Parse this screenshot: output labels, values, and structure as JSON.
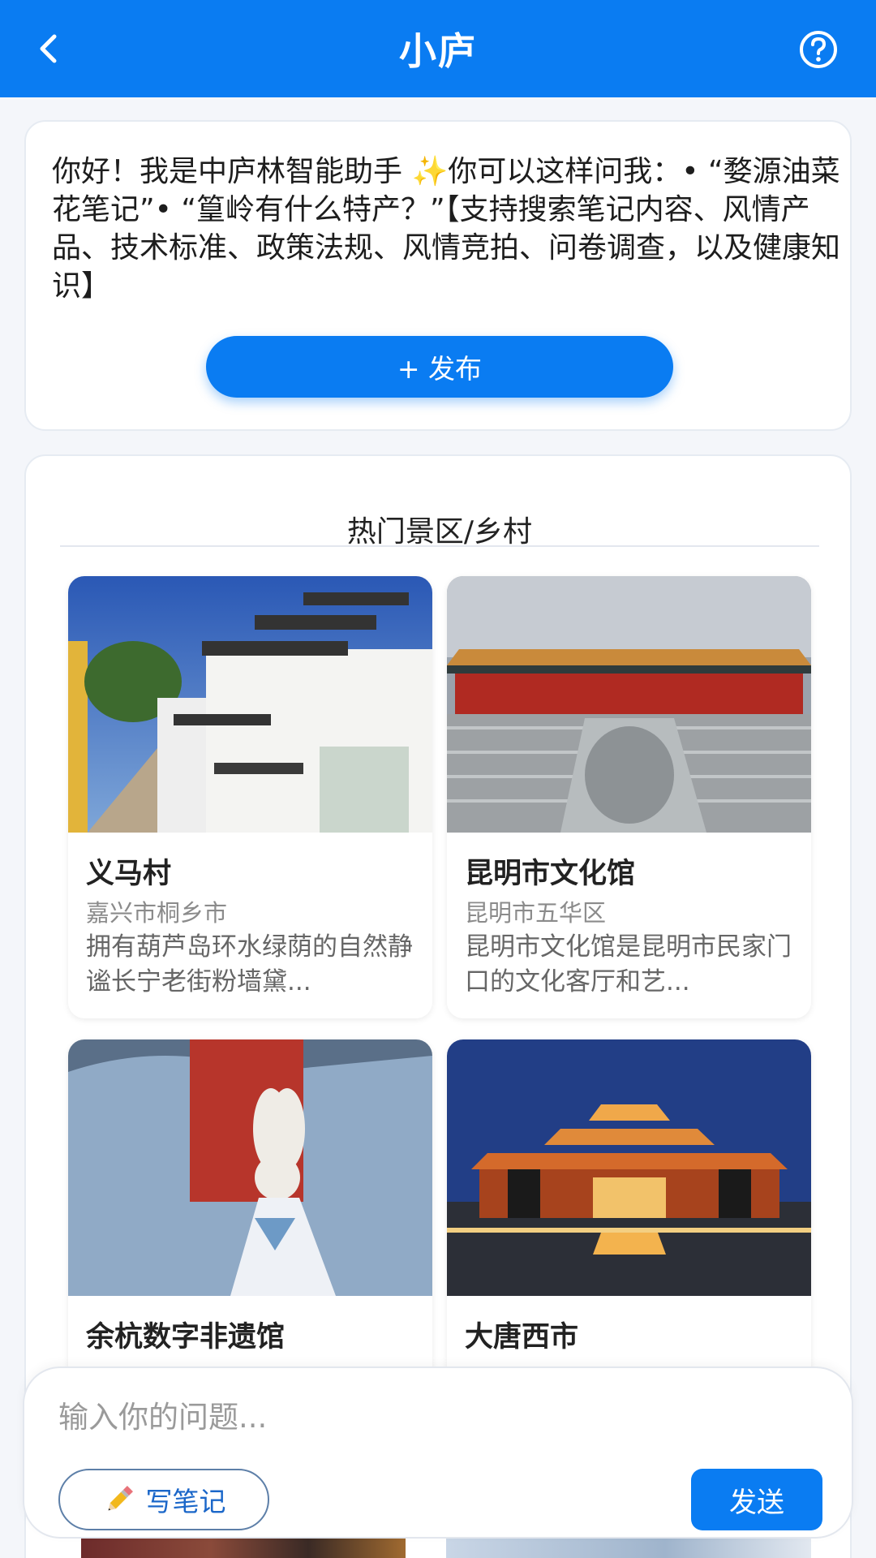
{
  "header": {
    "title": "小庐",
    "back_icon": "chevron-left-icon",
    "help_icon": "question-circle-icon",
    "bg_color": "#0a7cf2"
  },
  "intro": {
    "text": "你好！我是中庐林智能助手 ✨你可以这样问我：• “婺源油菜花笔记”• “篁岭有什么特产？”【支持搜索笔记内容、风情产品、技术标准、政策法规、风情竞拍、问卷调查，以及健康知识】",
    "publish_label": "+ 发布"
  },
  "hot": {
    "title": "热门景区/乡村",
    "places": [
      {
        "name": "义马村",
        "location": "嘉兴市桐乡市",
        "desc": "拥有葫芦岛环水绿荫的自然静谧长宁老街粉墙黛..."
      },
      {
        "name": "昆明市文化馆",
        "location": "昆明市五华区",
        "desc": "昆明市文化馆是昆明市民家门口的文化客厅和艺..."
      },
      {
        "name": "余杭数字非遗馆",
        "location": "",
        "desc": ""
      },
      {
        "name": "大唐西市",
        "location": "",
        "desc": ""
      }
    ]
  },
  "composer": {
    "placeholder": "输入你的问题...",
    "note_label": "写笔记",
    "note_icon": "pencil-icon",
    "send_label": "发送"
  }
}
